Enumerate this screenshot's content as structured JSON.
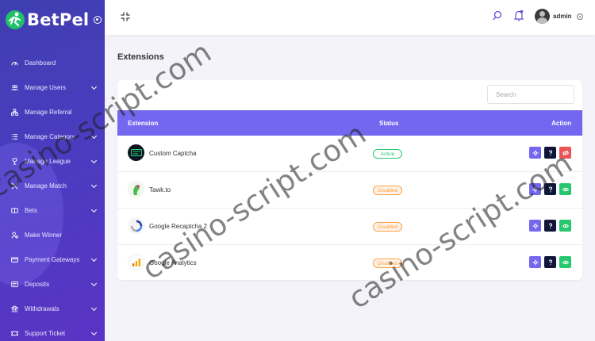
{
  "brand": {
    "name_part1": "Bet",
    "name_part2": "Pel"
  },
  "sidebar": {
    "items": [
      {
        "label": "Dashboard",
        "icon": "dashboard-icon",
        "submenu": false
      },
      {
        "label": "Manage Users",
        "icon": "users-icon",
        "submenu": true
      },
      {
        "label": "Manage Referral",
        "icon": "referral-icon",
        "submenu": false
      },
      {
        "label": "Manage Category",
        "icon": "list-icon",
        "submenu": true
      },
      {
        "label": "Manage League",
        "icon": "trophy-icon",
        "submenu": true
      },
      {
        "label": "Manage Match",
        "icon": "match-icon",
        "submenu": true
      },
      {
        "label": "Bets",
        "icon": "bets-icon",
        "submenu": true
      },
      {
        "label": "Make Winner",
        "icon": "winner-icon",
        "submenu": false
      },
      {
        "label": "Payment Gateways",
        "icon": "credit-card-icon",
        "submenu": true
      },
      {
        "label": "Deposits",
        "icon": "deposit-icon",
        "submenu": true
      },
      {
        "label": "Withdrawals",
        "icon": "bank-icon",
        "submenu": true
      },
      {
        "label": "Support Ticket",
        "icon": "ticket-icon",
        "submenu": true
      }
    ]
  },
  "header": {
    "user_name": "admin"
  },
  "page": {
    "title": "Extensions"
  },
  "search": {
    "placeholder": "Search",
    "value": ""
  },
  "table": {
    "columns": {
      "extension": "Extension",
      "status": "Status",
      "action": "Action"
    },
    "rows": [
      {
        "name": "Custom Captcha",
        "status": "Active",
        "logo": "custom-captcha-logo"
      },
      {
        "name": "Tawk.to",
        "status": "Disabled",
        "logo": "tawk-to-logo"
      },
      {
        "name": "Google Recaptcha 2",
        "status": "Disabled",
        "logo": "google-recaptcha-logo"
      },
      {
        "name": "Google Analytics",
        "status": "Disabled",
        "logo": "google-analytics-logo"
      }
    ]
  },
  "watermark": {
    "text": "casino-script.com"
  },
  "colors": {
    "sidebar": "#4a3cc0",
    "accent": "#7367f0",
    "active": "#28c76f",
    "disabled": "#ff9f43",
    "danger": "#ea5455",
    "dark": "#10163a"
  }
}
